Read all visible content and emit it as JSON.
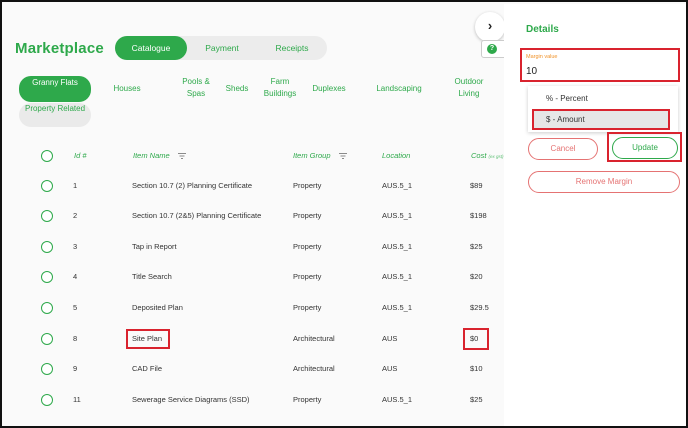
{
  "header": {
    "title": "Marketplace",
    "tabs": [
      {
        "label": "Catalogue",
        "active": true
      },
      {
        "label": "Payment",
        "active": false
      },
      {
        "label": "Receipts",
        "active": false
      }
    ],
    "collapse_icon": "chevron-right-icon"
  },
  "categories": [
    {
      "label": "Granny Flats",
      "active": true
    },
    {
      "label": "Houses"
    },
    {
      "label": "Pools & Spas"
    },
    {
      "label": "Sheds"
    },
    {
      "label": "Farm Buildings"
    },
    {
      "label": "Duplexes"
    },
    {
      "label": "Landscaping"
    },
    {
      "label": "Outdoor Living"
    },
    {
      "label": "Property Related"
    }
  ],
  "table": {
    "columns": {
      "id": "Id #",
      "name": "Item Name",
      "group": "Item Group",
      "location": "Location",
      "cost": "Cost",
      "cost_suffix": "(ex gst)"
    },
    "rows": [
      {
        "id": "1",
        "name": "Section 10.7 (2) Planning Certificate",
        "group": "Property",
        "location": "AUS.5_1",
        "cost": "$89"
      },
      {
        "id": "2",
        "name": "Section 10.7 (2&5) Planning Certificate",
        "group": "Property",
        "location": "AUS.5_1",
        "cost": "$198"
      },
      {
        "id": "3",
        "name": "Tap in Report",
        "group": "Property",
        "location": "AUS.5_1",
        "cost": "$25"
      },
      {
        "id": "4",
        "name": "Title Search",
        "group": "Property",
        "location": "AUS.5_1",
        "cost": "$20"
      },
      {
        "id": "5",
        "name": "Deposited Plan",
        "group": "Property",
        "location": "AUS.5_1",
        "cost": "$29.5"
      },
      {
        "id": "8",
        "name": "Site Plan",
        "group": "Architectural",
        "location": "AUS",
        "cost": "$0"
      },
      {
        "id": "9",
        "name": "CAD File",
        "group": "Architectural",
        "location": "AUS",
        "cost": "$10"
      },
      {
        "id": "11",
        "name": "Sewerage Service Diagrams (SSD)",
        "group": "Property",
        "location": "AUS.5_1",
        "cost": "$25"
      }
    ]
  },
  "details": {
    "title": "Details",
    "margin_label": "Margin value",
    "margin_value": "10",
    "options": [
      {
        "label": "% - Percent",
        "selected": false
      },
      {
        "label": "$ - Amount",
        "selected": true
      }
    ],
    "cancel_label": "Cancel",
    "update_label": "Update",
    "remove_label": "Remove Margin"
  },
  "colors": {
    "brand": "#2ea94b",
    "danger": "#e57373",
    "highlight": "#d9232e"
  }
}
